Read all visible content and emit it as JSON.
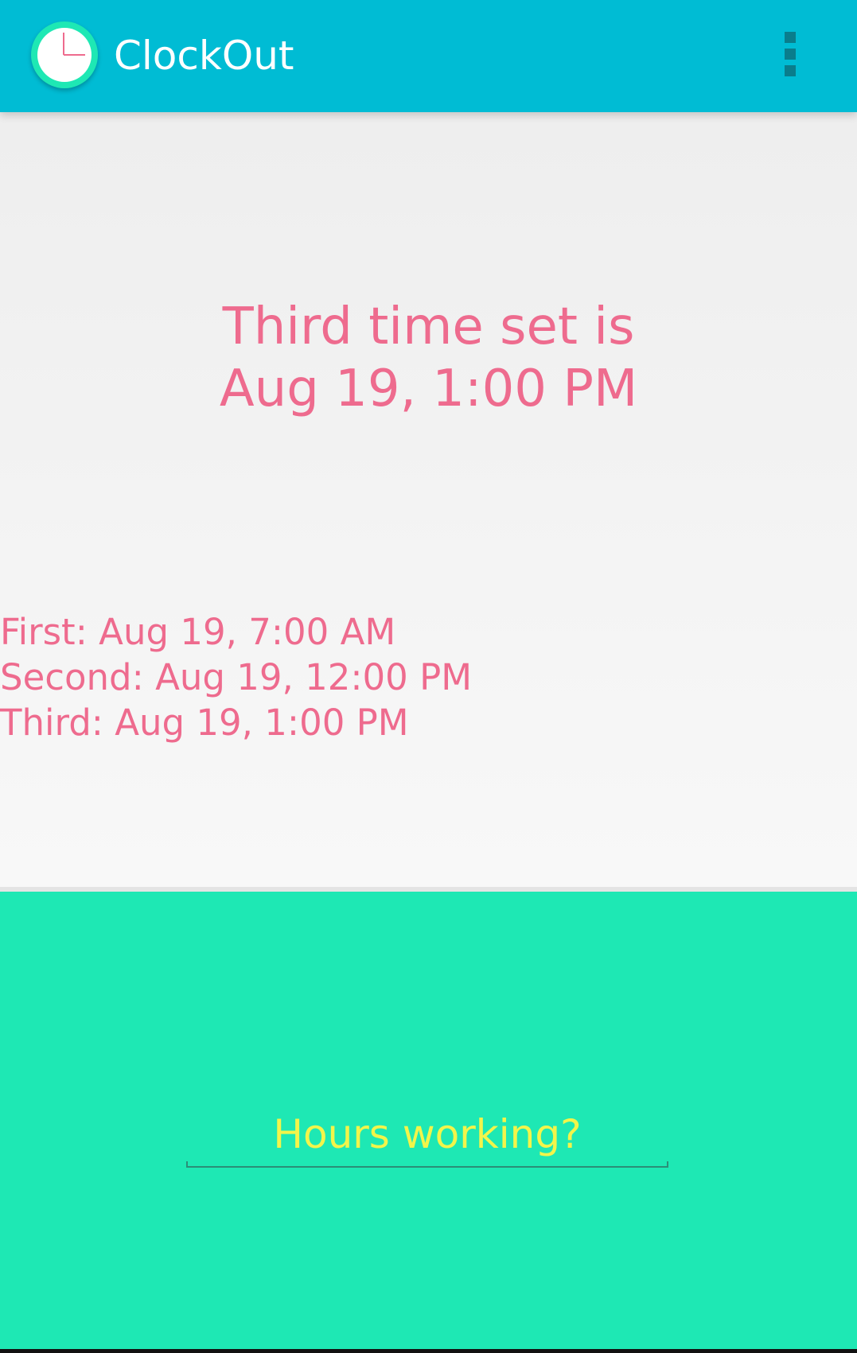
{
  "app_bar": {
    "title": "ClockOut",
    "icon": "clock-icon",
    "menu_icon": "overflow-menu-icon",
    "background_color": "#00bcd4"
  },
  "status": {
    "line1": "Third time set is",
    "line2": "Aug 19, 1:00 PM"
  },
  "times": [
    {
      "label": "First: Aug 19, 7:00 AM"
    },
    {
      "label": "Second: Aug 19, 12:00 PM"
    },
    {
      "label": "Third: Aug 19, 1:00 PM"
    }
  ],
  "hours_input": {
    "placeholder": "Hours working?",
    "value": ""
  },
  "colors": {
    "accent_pink": "#ee6b8e",
    "panel_green": "#1ee8b4",
    "input_text_yellow": "#f2f54a"
  }
}
